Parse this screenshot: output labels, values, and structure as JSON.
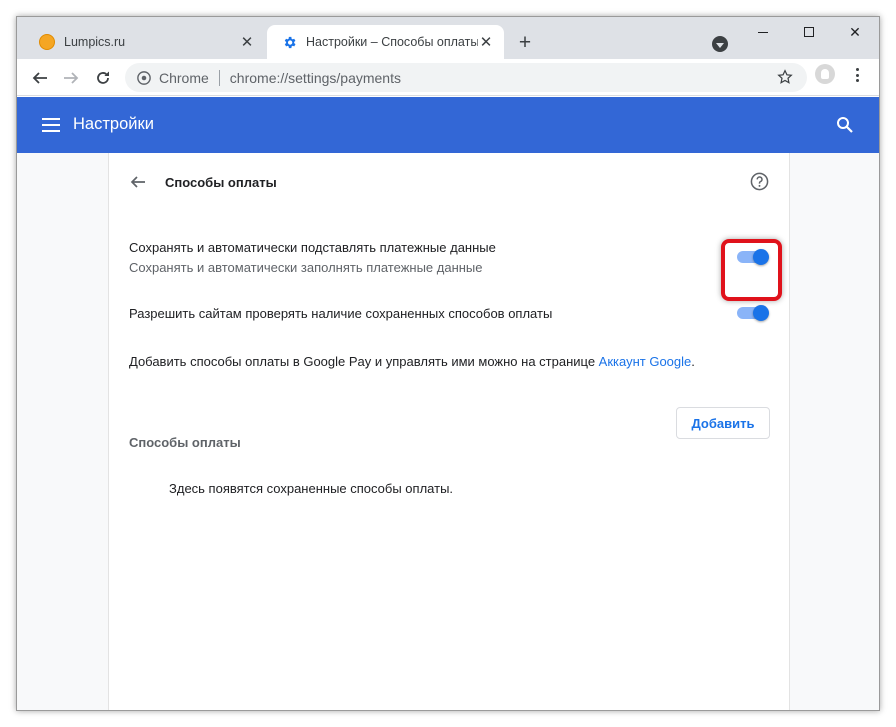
{
  "tabs": [
    {
      "label": "Lumpics.ru",
      "icon": "orange-circle-icon",
      "active": false
    },
    {
      "label": "Настройки – Способы оплаты",
      "icon": "gear-icon",
      "active": true
    }
  ],
  "toolbar": {
    "omnibox_site": "Chrome",
    "omnibox_url": "chrome://settings/payments"
  },
  "header": {
    "title": "Настройки"
  },
  "subpage": {
    "title": "Способы оплаты"
  },
  "settings": {
    "save_autofill": {
      "label": "Сохранять и автоматически подставлять платежные данные",
      "sublabel": "Сохранять и автоматически заполнять платежные данные",
      "enabled": true
    },
    "allow_check": {
      "label": "Разрешить сайтам проверять наличие сохраненных способов оплаты",
      "enabled": true
    },
    "google_pay": {
      "text": "Добавить способы оплаты в Google Pay и управлять ими можно на странице ",
      "link": "Аккаунт Google",
      "suffix": "."
    }
  },
  "payment_methods": {
    "title": "Способы оплаты",
    "add_label": "Добавить",
    "empty_text": "Здесь появятся сохраненные способы оплаты."
  },
  "colors": {
    "header_bg": "#3367d6",
    "toggle_on": "#1a73e8",
    "highlight": "#e0121b"
  }
}
